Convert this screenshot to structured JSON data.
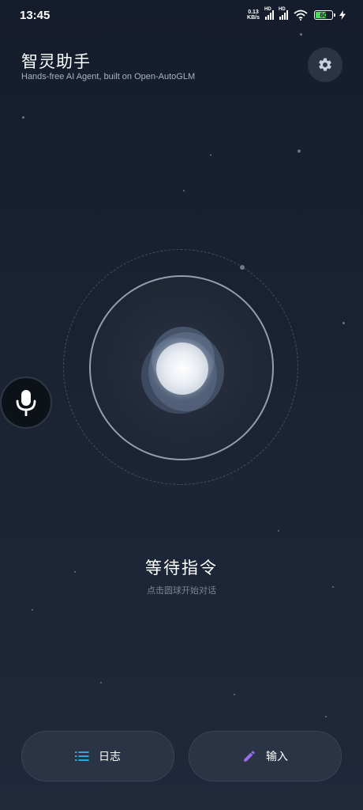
{
  "status_bar": {
    "time": "13:45",
    "net_speed_value": "0.13",
    "net_speed_unit": "KB/s",
    "signal1_label": "HD",
    "signal2_label": "HD",
    "battery_level": "60"
  },
  "header": {
    "title": "智灵助手",
    "subtitle": "Hands-free AI Agent, built on Open-AutoGLM",
    "settings_icon": "gear-icon"
  },
  "orb": {
    "icon": "voice-orb"
  },
  "mic": {
    "icon": "microphone-icon"
  },
  "status": {
    "title": "等待指令",
    "hint": "点击圆球开始对话"
  },
  "actions": {
    "log_label": "日志",
    "log_icon": "list-icon",
    "input_label": "输入",
    "input_icon": "pencil-icon"
  },
  "colors": {
    "accent_list": "#29a8e0",
    "accent_pencil": "#9b6cf0",
    "battery_fill": "#4cd964",
    "background": "#1b2333"
  }
}
